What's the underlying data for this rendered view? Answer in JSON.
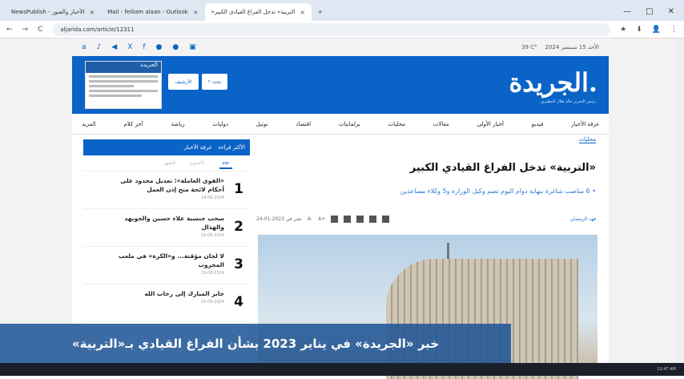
{
  "browser": {
    "tabs": [
      {
        "label": "NewsPublish - الأخبار والصور",
        "active": false
      },
      {
        "label": "Mail - feiliam alaan - Outlook",
        "active": false
      },
      {
        "label": "«التربية» تدخل الفراغ القيادي الكبير",
        "active": true
      }
    ],
    "new_tab": "+",
    "window_controls": [
      "—",
      "□",
      "✕"
    ],
    "nav": {
      "back": "←",
      "forward": "→",
      "reload": "C"
    },
    "url": "aljarida.com/article/12311",
    "right_icons": [
      "★",
      "⬇",
      "👤",
      "⋮"
    ]
  },
  "site": {
    "date_text": "الأحد 15 سبتمبر 2024",
    "weather": "39 C°",
    "social_icons": [
      "a",
      "♪",
      "◀",
      "X",
      "f",
      "●",
      "●",
      "▣"
    ],
    "logo": "الجريدة.",
    "editor": "رئيس التحرير خالد هلال المطيري",
    "archive_button": "الأرشيف",
    "search_button": "بحث",
    "paper_title": "الجريدة",
    "nav": [
      "غرفة الأخبار",
      "فيديو",
      "أخبار الأولى",
      "مقالات",
      "محليات",
      "برلمانيات",
      "اقتصاد",
      "توثيل",
      "دوليات",
      "رياضة",
      "آخر كلام",
      "المزيد"
    ]
  },
  "sidebar": {
    "tabs": [
      "الأكثر قراءة",
      "غرفة الأخبار"
    ],
    "periods": [
      "الشهر",
      "الأسبوع",
      "يوم"
    ],
    "items": [
      {
        "num": "1",
        "title": "«القوى العاملة»: تعديل محدود على أحكام لائحة منح إذن العمل",
        "date": "14-09-2024"
      },
      {
        "num": "2",
        "title": "سحب جنسية علاء حسين والجويهد والهذال",
        "date": "15-09-2024"
      },
      {
        "num": "3",
        "title": "لا لجان مؤقتة... و«الكرة» في ملعب المجروب",
        "date": "15-09-2024"
      },
      {
        "num": "4",
        "title": "جابر المبارك إلى رحاب الله",
        "date": "15-09-2024"
      }
    ]
  },
  "article": {
    "category": "محليات",
    "title": "«التربية» تدخل الفراغ القيادي الكبير",
    "subtitle": "• 6 مناصب شاغرة بنهاية دوام اليوم تضم وكيل الوزارة و5 وكلاء مساعدين",
    "author": "فهد الرمضان",
    "published": "نشر في 2023-01-24",
    "font_controls": [
      "A+",
      "A-"
    ]
  },
  "caption": "خبر «الجريدة» في يناير 2023 بشأن الفراغ القيادي بـ«التربية»",
  "taskbar": {
    "time": "12:47 AM"
  }
}
